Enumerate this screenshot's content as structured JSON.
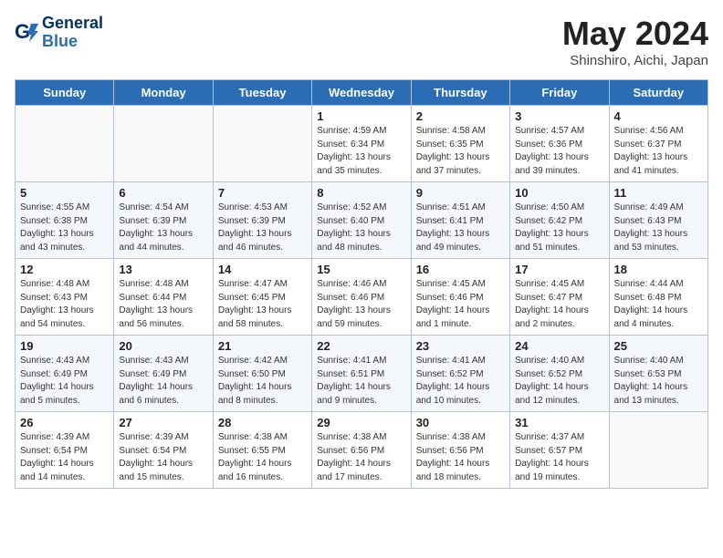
{
  "header": {
    "logo_line1": "General",
    "logo_line2": "Blue",
    "month": "May 2024",
    "location": "Shinshiro, Aichi, Japan"
  },
  "weekdays": [
    "Sunday",
    "Monday",
    "Tuesday",
    "Wednesday",
    "Thursday",
    "Friday",
    "Saturday"
  ],
  "weeks": [
    [
      {
        "day": "",
        "info": ""
      },
      {
        "day": "",
        "info": ""
      },
      {
        "day": "",
        "info": ""
      },
      {
        "day": "1",
        "info": "Sunrise: 4:59 AM\nSunset: 6:34 PM\nDaylight: 13 hours\nand 35 minutes."
      },
      {
        "day": "2",
        "info": "Sunrise: 4:58 AM\nSunset: 6:35 PM\nDaylight: 13 hours\nand 37 minutes."
      },
      {
        "day": "3",
        "info": "Sunrise: 4:57 AM\nSunset: 6:36 PM\nDaylight: 13 hours\nand 39 minutes."
      },
      {
        "day": "4",
        "info": "Sunrise: 4:56 AM\nSunset: 6:37 PM\nDaylight: 13 hours\nand 41 minutes."
      }
    ],
    [
      {
        "day": "5",
        "info": "Sunrise: 4:55 AM\nSunset: 6:38 PM\nDaylight: 13 hours\nand 43 minutes."
      },
      {
        "day": "6",
        "info": "Sunrise: 4:54 AM\nSunset: 6:39 PM\nDaylight: 13 hours\nand 44 minutes."
      },
      {
        "day": "7",
        "info": "Sunrise: 4:53 AM\nSunset: 6:39 PM\nDaylight: 13 hours\nand 46 minutes."
      },
      {
        "day": "8",
        "info": "Sunrise: 4:52 AM\nSunset: 6:40 PM\nDaylight: 13 hours\nand 48 minutes."
      },
      {
        "day": "9",
        "info": "Sunrise: 4:51 AM\nSunset: 6:41 PM\nDaylight: 13 hours\nand 49 minutes."
      },
      {
        "day": "10",
        "info": "Sunrise: 4:50 AM\nSunset: 6:42 PM\nDaylight: 13 hours\nand 51 minutes."
      },
      {
        "day": "11",
        "info": "Sunrise: 4:49 AM\nSunset: 6:43 PM\nDaylight: 13 hours\nand 53 minutes."
      }
    ],
    [
      {
        "day": "12",
        "info": "Sunrise: 4:48 AM\nSunset: 6:43 PM\nDaylight: 13 hours\nand 54 minutes."
      },
      {
        "day": "13",
        "info": "Sunrise: 4:48 AM\nSunset: 6:44 PM\nDaylight: 13 hours\nand 56 minutes."
      },
      {
        "day": "14",
        "info": "Sunrise: 4:47 AM\nSunset: 6:45 PM\nDaylight: 13 hours\nand 58 minutes."
      },
      {
        "day": "15",
        "info": "Sunrise: 4:46 AM\nSunset: 6:46 PM\nDaylight: 13 hours\nand 59 minutes."
      },
      {
        "day": "16",
        "info": "Sunrise: 4:45 AM\nSunset: 6:46 PM\nDaylight: 14 hours\nand 1 minute."
      },
      {
        "day": "17",
        "info": "Sunrise: 4:45 AM\nSunset: 6:47 PM\nDaylight: 14 hours\nand 2 minutes."
      },
      {
        "day": "18",
        "info": "Sunrise: 4:44 AM\nSunset: 6:48 PM\nDaylight: 14 hours\nand 4 minutes."
      }
    ],
    [
      {
        "day": "19",
        "info": "Sunrise: 4:43 AM\nSunset: 6:49 PM\nDaylight: 14 hours\nand 5 minutes."
      },
      {
        "day": "20",
        "info": "Sunrise: 4:43 AM\nSunset: 6:49 PM\nDaylight: 14 hours\nand 6 minutes."
      },
      {
        "day": "21",
        "info": "Sunrise: 4:42 AM\nSunset: 6:50 PM\nDaylight: 14 hours\nand 8 minutes."
      },
      {
        "day": "22",
        "info": "Sunrise: 4:41 AM\nSunset: 6:51 PM\nDaylight: 14 hours\nand 9 minutes."
      },
      {
        "day": "23",
        "info": "Sunrise: 4:41 AM\nSunset: 6:52 PM\nDaylight: 14 hours\nand 10 minutes."
      },
      {
        "day": "24",
        "info": "Sunrise: 4:40 AM\nSunset: 6:52 PM\nDaylight: 14 hours\nand 12 minutes."
      },
      {
        "day": "25",
        "info": "Sunrise: 4:40 AM\nSunset: 6:53 PM\nDaylight: 14 hours\nand 13 minutes."
      }
    ],
    [
      {
        "day": "26",
        "info": "Sunrise: 4:39 AM\nSunset: 6:54 PM\nDaylight: 14 hours\nand 14 minutes."
      },
      {
        "day": "27",
        "info": "Sunrise: 4:39 AM\nSunset: 6:54 PM\nDaylight: 14 hours\nand 15 minutes."
      },
      {
        "day": "28",
        "info": "Sunrise: 4:38 AM\nSunset: 6:55 PM\nDaylight: 14 hours\nand 16 minutes."
      },
      {
        "day": "29",
        "info": "Sunrise: 4:38 AM\nSunset: 6:56 PM\nDaylight: 14 hours\nand 17 minutes."
      },
      {
        "day": "30",
        "info": "Sunrise: 4:38 AM\nSunset: 6:56 PM\nDaylight: 14 hours\nand 18 minutes."
      },
      {
        "day": "31",
        "info": "Sunrise: 4:37 AM\nSunset: 6:57 PM\nDaylight: 14 hours\nand 19 minutes."
      },
      {
        "day": "",
        "info": ""
      }
    ]
  ]
}
